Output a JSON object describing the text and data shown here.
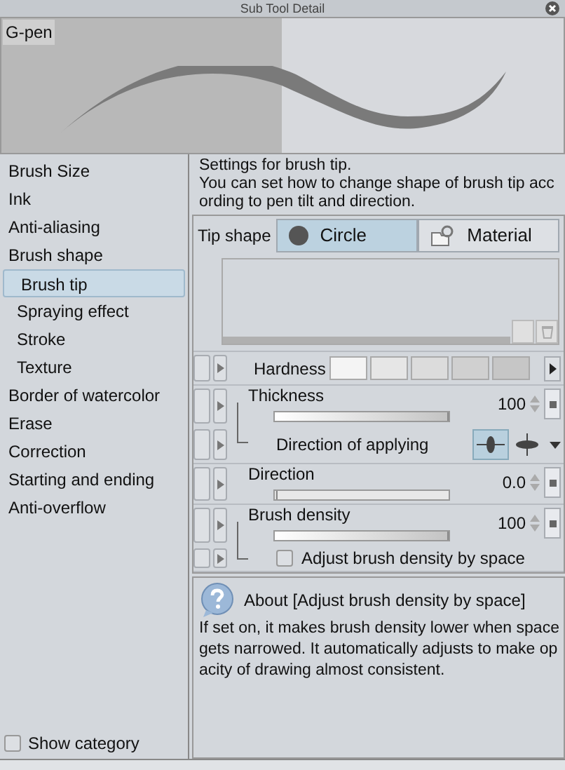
{
  "window": {
    "title": "Sub Tool Detail"
  },
  "preview": {
    "label": "G-pen"
  },
  "sidebar": {
    "items": [
      {
        "label": "Brush Size",
        "selected": false
      },
      {
        "label": "Ink",
        "selected": false
      },
      {
        "label": "Anti-aliasing",
        "selected": false
      },
      {
        "label": "Brush shape",
        "selected": false,
        "children": [
          {
            "label": "Brush tip",
            "selected": true
          },
          {
            "label": "Spraying effect",
            "selected": false
          },
          {
            "label": "Stroke",
            "selected": false
          },
          {
            "label": "Texture",
            "selected": false
          }
        ]
      },
      {
        "label": "Border of watercolor",
        "selected": false
      },
      {
        "label": "Erase",
        "selected": false
      },
      {
        "label": "Correction",
        "selected": false
      },
      {
        "label": "Starting and ending",
        "selected": false
      },
      {
        "label": "Anti-overflow",
        "selected": false
      }
    ],
    "show_category": {
      "label": "Show category",
      "checked": false
    }
  },
  "description": [
    "Settings for brush tip.",
    "You can set how to change shape of brush tip acc",
    "ording to pen tilt and direction."
  ],
  "tip_shape": {
    "label": "Tip shape",
    "options": [
      {
        "label": "Circle",
        "kind": "circle",
        "selected": true
      },
      {
        "label": "Material",
        "kind": "material",
        "selected": false
      }
    ]
  },
  "settings": [
    {
      "kind": "hardness",
      "label": "Hardness"
    },
    {
      "kind": "slider",
      "label": "Thickness",
      "value": "100",
      "level": 1,
      "linked": true
    },
    {
      "kind": "direction",
      "label": "Direction of applying",
      "options": [
        {
          "selected": true
        },
        {
          "selected": false
        }
      ]
    },
    {
      "kind": "slider",
      "label": "Direction",
      "value": "0.0",
      "level": 0,
      "linked": false
    },
    {
      "kind": "slider",
      "label": "Brush density",
      "value": "100",
      "level": 1,
      "linked": true
    },
    {
      "kind": "checkbox",
      "label": "Adjust brush density by space",
      "checked": false
    }
  ],
  "help": {
    "title": "About [Adjust brush density by space]",
    "lines": [
      "If set on, it makes brush density lower when space",
      "gets narrowed. It automatically adjusts to make op",
      "acity of drawing almost consistent."
    ]
  }
}
